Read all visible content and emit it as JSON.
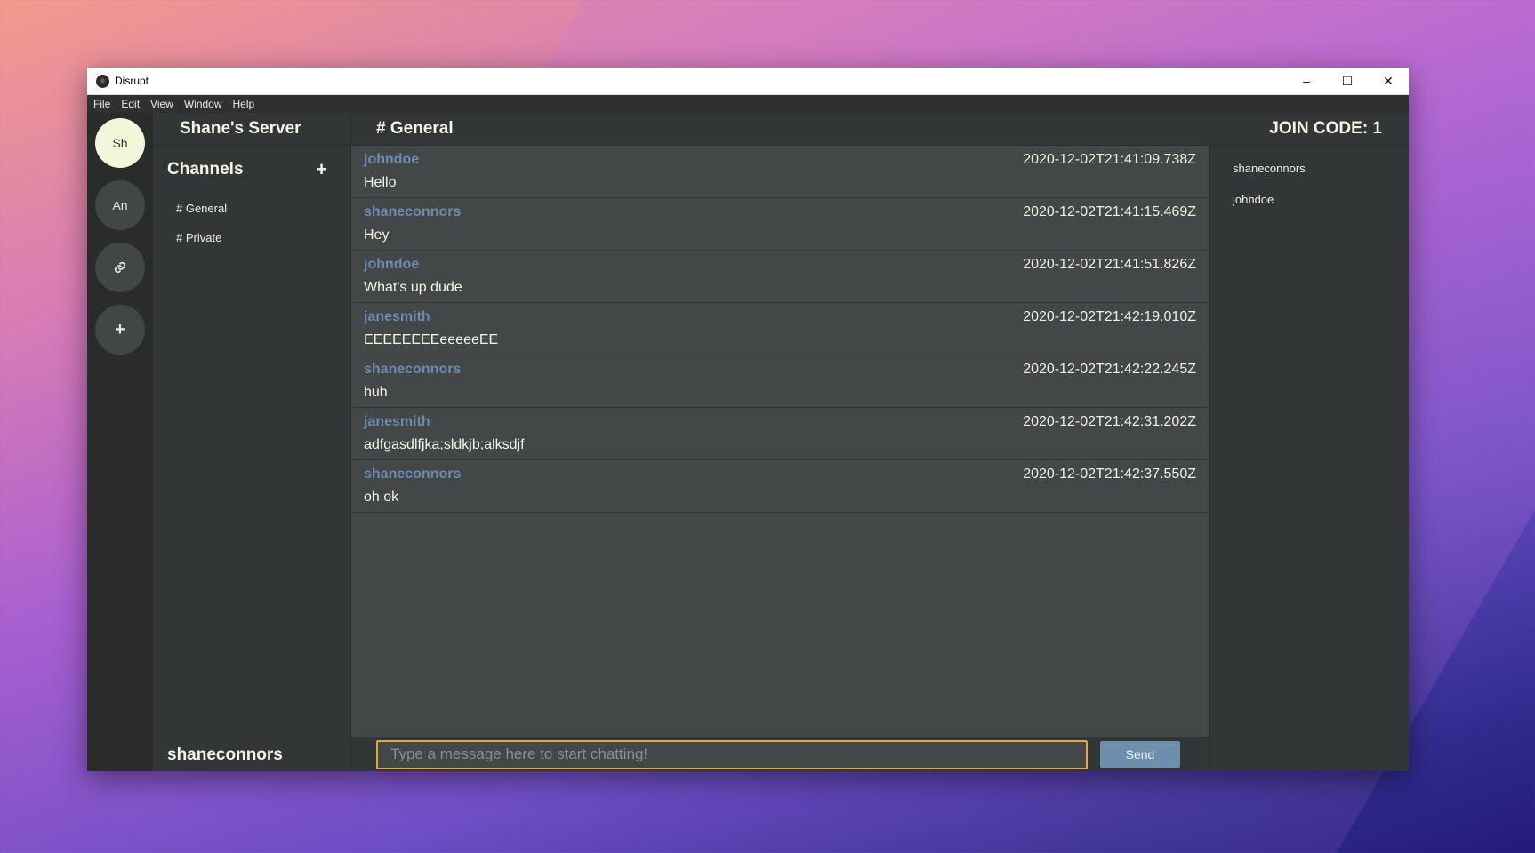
{
  "window": {
    "title": "Disrupt",
    "controls": {
      "minimize": "–",
      "maximize": "☐",
      "close": "✕"
    }
  },
  "menu": [
    "File",
    "Edit",
    "View",
    "Window",
    "Help"
  ],
  "servers": [
    {
      "label": "Sh",
      "active": true
    },
    {
      "label": "An",
      "active": false
    },
    {
      "icon": "link-icon",
      "glyph": "🔗"
    },
    {
      "icon": "plus-icon",
      "glyph": "+"
    }
  ],
  "server_name": "Shane's Server",
  "channels": {
    "title": "Channels",
    "add_glyph": "+",
    "items": [
      "# General",
      "# Private"
    ]
  },
  "current_user": "shaneconnors",
  "header": {
    "channel": "# General",
    "join_code": "JOIN CODE: 1"
  },
  "messages": [
    {
      "author": "johndoe",
      "time": "2020-12-02T21:41:09.738Z",
      "text": "Hello"
    },
    {
      "author": "shaneconnors",
      "time": "2020-12-02T21:41:15.469Z",
      "text": "Hey"
    },
    {
      "author": "johndoe",
      "time": "2020-12-02T21:41:51.826Z",
      "text": "What's up dude"
    },
    {
      "author": "janesmith",
      "time": "2020-12-02T21:42:19.010Z",
      "text": "EEEEEEEEeeeeeEE"
    },
    {
      "author": "shaneconnors",
      "time": "2020-12-02T21:42:22.245Z",
      "text": "huh"
    },
    {
      "author": "janesmith",
      "time": "2020-12-02T21:42:31.202Z",
      "text": "adfgasdlfjka;sldkjb;alksdjf"
    },
    {
      "author": "shaneconnors",
      "time": "2020-12-02T21:42:37.550Z",
      "text": "oh ok"
    }
  ],
  "composer": {
    "placeholder": "Type a message here to start chatting!",
    "send_label": "Send"
  },
  "members": [
    "shaneconnors",
    "johndoe"
  ],
  "colors": {
    "accent_author": "#6b8cb0",
    "input_focus": "#e0a93a",
    "send_button": "#6c8fae"
  }
}
